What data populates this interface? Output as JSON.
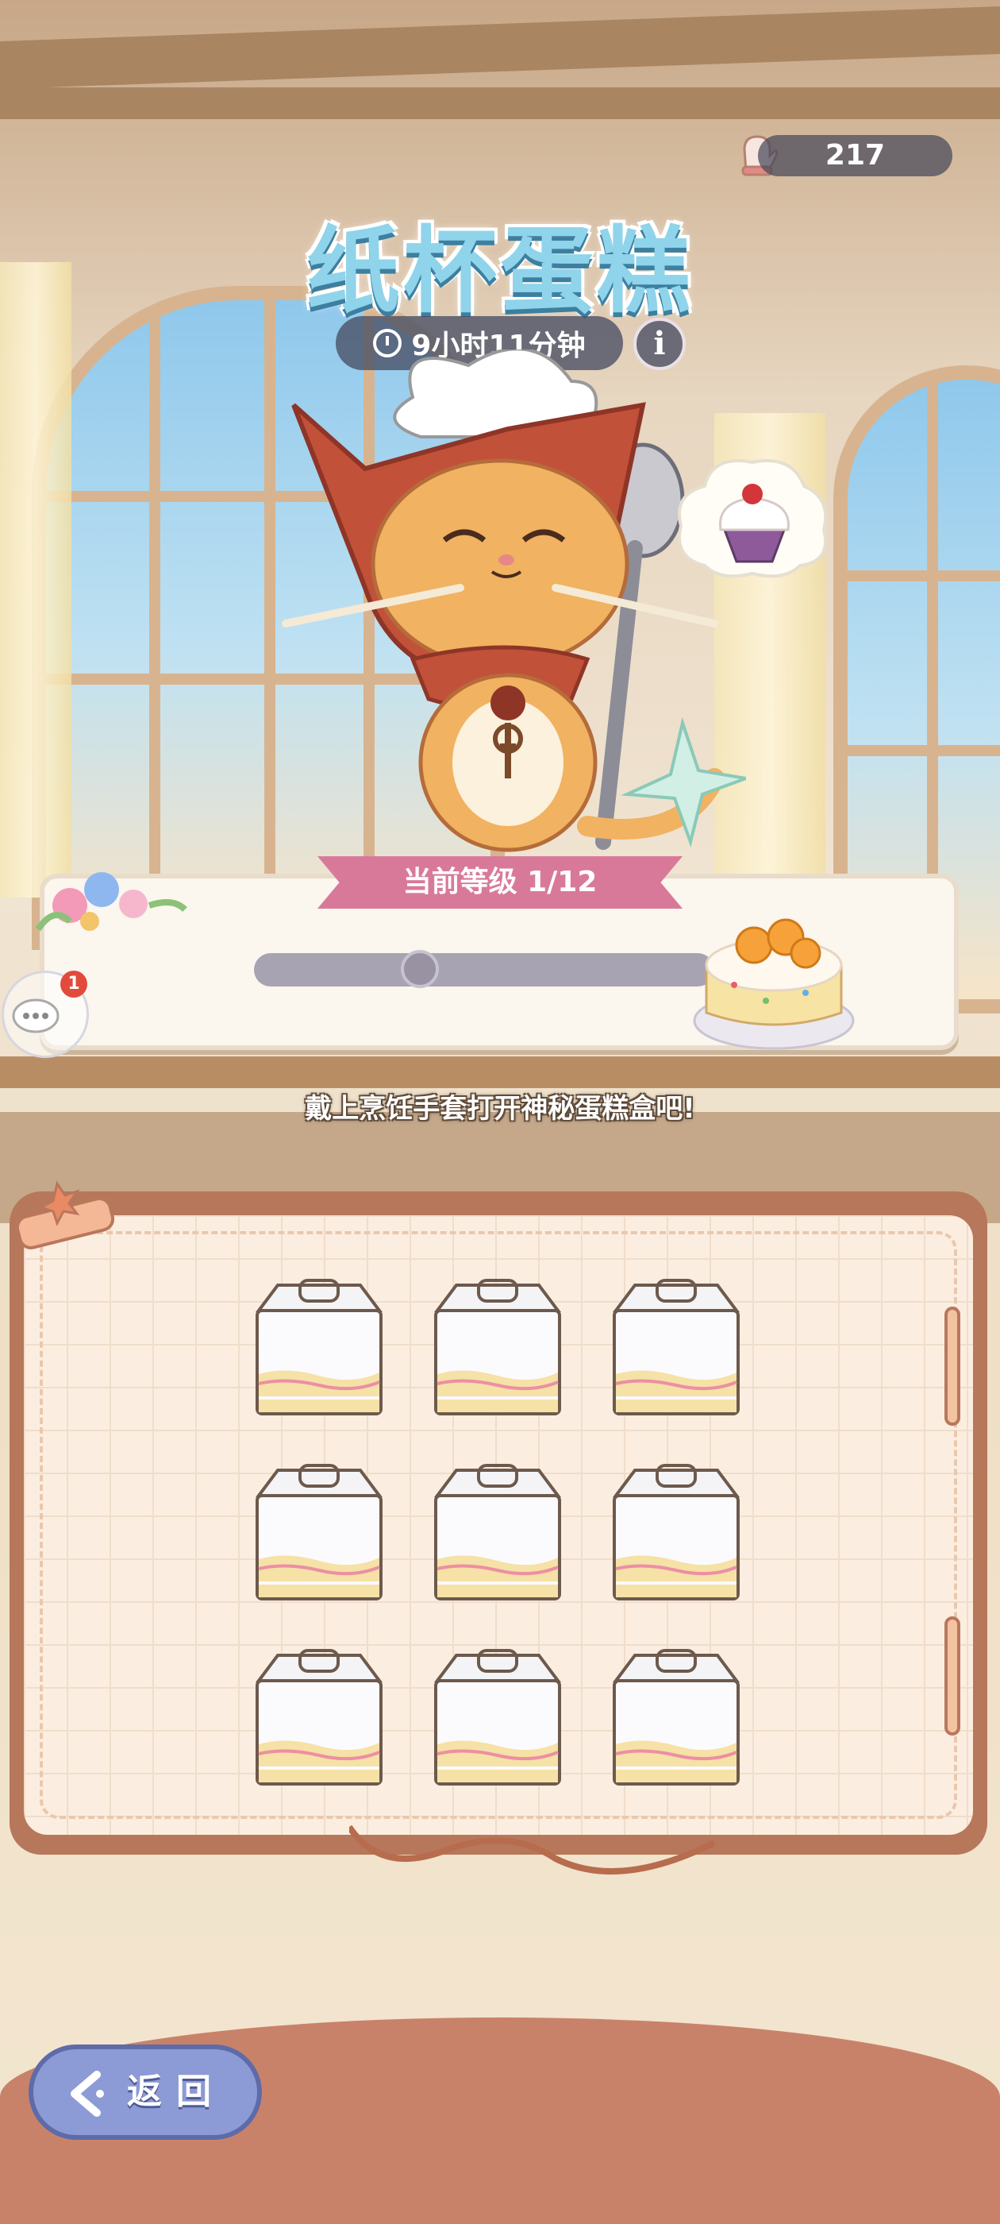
{
  "header": {
    "currency_value": "217",
    "currency_icon": "oven-mitt-icon",
    "title": "纸杯蛋糕",
    "timer_text": "9小时11分钟",
    "info_label": "i"
  },
  "level": {
    "label": "当前等级  1/12",
    "progress": 0.36
  },
  "chat": {
    "badge_count": "1"
  },
  "hint": "戴上烹饪手套打开神秘蛋糕盒吧!",
  "boxes": {
    "count": 9,
    "icon": "mystery-cake-box-icon"
  },
  "back_button": {
    "label": "返回"
  },
  "colors": {
    "title": "#8fd4ea",
    "ribbon": "#d9799a",
    "back_button": "#8c9ad6",
    "board_border": "#b7775a"
  }
}
